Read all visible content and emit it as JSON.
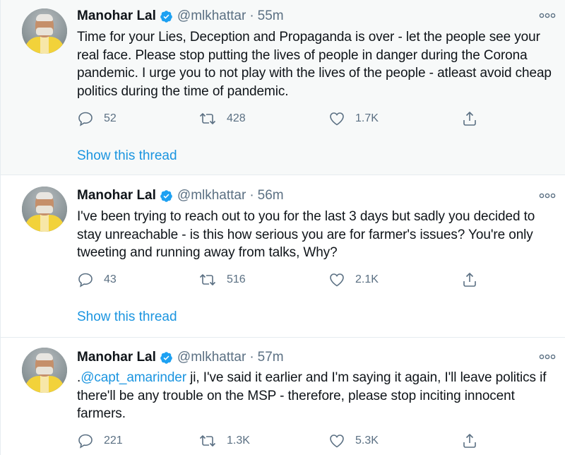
{
  "tweets": [
    {
      "author": "Manohar Lal",
      "handle": "@mlkhattar",
      "separator": "·",
      "time": "55m",
      "text": "Time for your Lies, Deception and Propaganda is over - let the people see your real face. Please stop putting the lives of people in danger during the Corona pandemic. I urge you to not play with the lives of the people - atleast avoid cheap politics during the time of pandemic.",
      "replies": "52",
      "retweets": "428",
      "likes": "1.7K",
      "show_thread": "Show this thread"
    },
    {
      "author": "Manohar Lal",
      "handle": "@mlkhattar",
      "separator": "·",
      "time": "56m",
      "text": "I've been trying to reach out to you for the last 3 days but sadly you decided to stay unreachable - is this how serious you are for farmer's issues? You're only tweeting and running away from talks, Why?",
      "replies": "43",
      "retweets": "516",
      "likes": "2.1K",
      "show_thread": "Show this thread"
    },
    {
      "author": "Manohar Lal",
      "handle": "@mlkhattar",
      "separator": "·",
      "time": "57m",
      "text_prefix": ".",
      "mention": "@capt_amarinder",
      "text": " ji, I've said it earlier and I'm saying it again, I'll leave politics if there'll be any trouble on the MSP - therefore, please stop inciting innocent farmers.",
      "replies": "221",
      "retweets": "1.3K",
      "likes": "5.3K"
    }
  ],
  "icons": {
    "verified": "verified-badge-icon",
    "more": "more-icon",
    "reply": "reply-icon",
    "retweet": "retweet-icon",
    "like": "like-icon",
    "share": "share-icon"
  },
  "colors": {
    "link": "#1b95e0",
    "secondary_text": "#5b7083",
    "verified": "#1da1f2",
    "highlight_bg": "#f7f9f9"
  }
}
